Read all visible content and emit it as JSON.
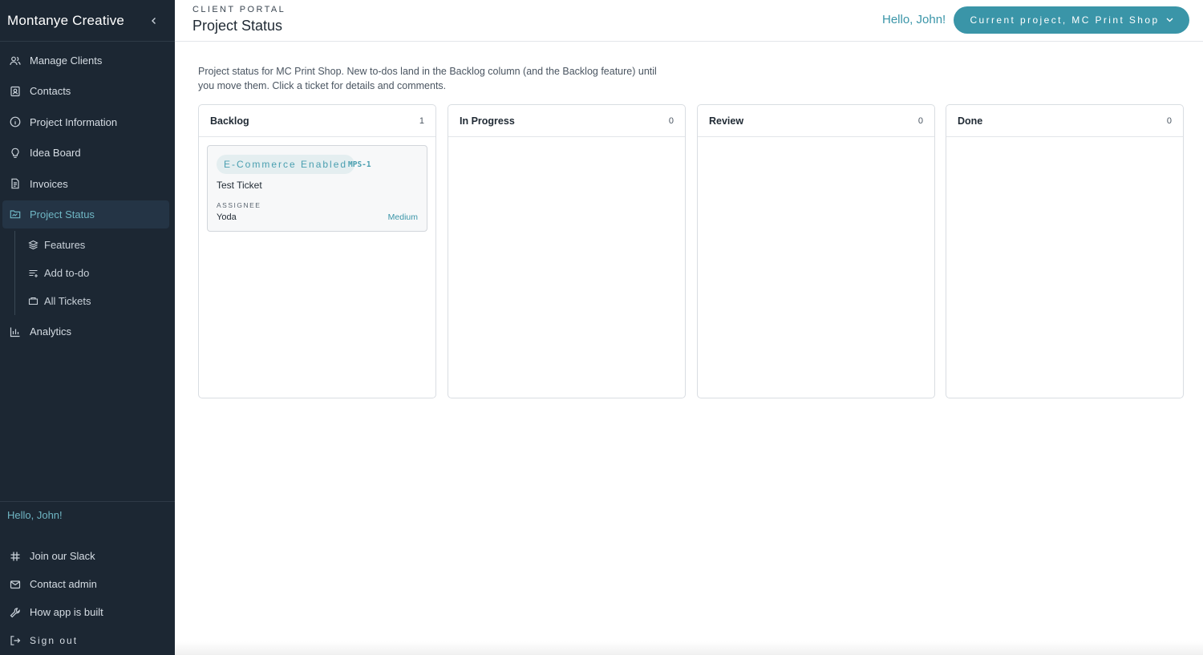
{
  "sidebar": {
    "brand": "Montanye Creative",
    "nav": [
      {
        "label": "Manage Clients",
        "icon": "users-icon"
      },
      {
        "label": "Contacts",
        "icon": "contact-card-icon"
      },
      {
        "label": "Project Information",
        "icon": "info-circle-icon"
      },
      {
        "label": "Idea Board",
        "icon": "lightbulb-icon"
      },
      {
        "label": "Invoices",
        "icon": "document-icon"
      },
      {
        "label": "Project Status",
        "icon": "folder-icon",
        "active": true
      }
    ],
    "subnav": [
      {
        "label": "Features",
        "icon": "layers-icon"
      },
      {
        "label": "Add to-do",
        "icon": "list-add-icon"
      },
      {
        "label": "All Tickets",
        "icon": "ticket-icon"
      }
    ],
    "analytics": {
      "label": "Analytics",
      "icon": "bar-chart-icon"
    },
    "hello": "Hello, John!",
    "footer": [
      {
        "label": "Join our Slack",
        "icon": "slack-icon"
      },
      {
        "label": "Contact admin",
        "icon": "mail-icon"
      },
      {
        "label": "How app is built",
        "icon": "wrench-icon"
      },
      {
        "label": "Sign out",
        "icon": "sign-out-icon"
      }
    ]
  },
  "header": {
    "eyebrow": "CLIENT PORTAL",
    "title": "Project Status",
    "hello": "Hello, John!",
    "project_button": "Current project, MC Print Shop"
  },
  "main": {
    "intro": "Project status for MC Print Shop. New to-dos land in the Backlog column (and the Backlog feature) until you move them. Click a ticket for details and comments.",
    "columns": [
      {
        "title": "Backlog",
        "count": "1"
      },
      {
        "title": "In Progress",
        "count": "0"
      },
      {
        "title": "Review",
        "count": "0"
      },
      {
        "title": "Done",
        "count": "0"
      }
    ],
    "ticket": {
      "feature": "E-Commerce Enabled",
      "id": "MPS-1",
      "title": "Test Ticket",
      "assignee_label": "ASSIGNEE",
      "assignee": "Yoda",
      "priority": "Medium"
    }
  },
  "colors": {
    "sidebar_bg": "#1c2733",
    "accent": "#3a95a8",
    "active_text": "#6fb6c4"
  }
}
